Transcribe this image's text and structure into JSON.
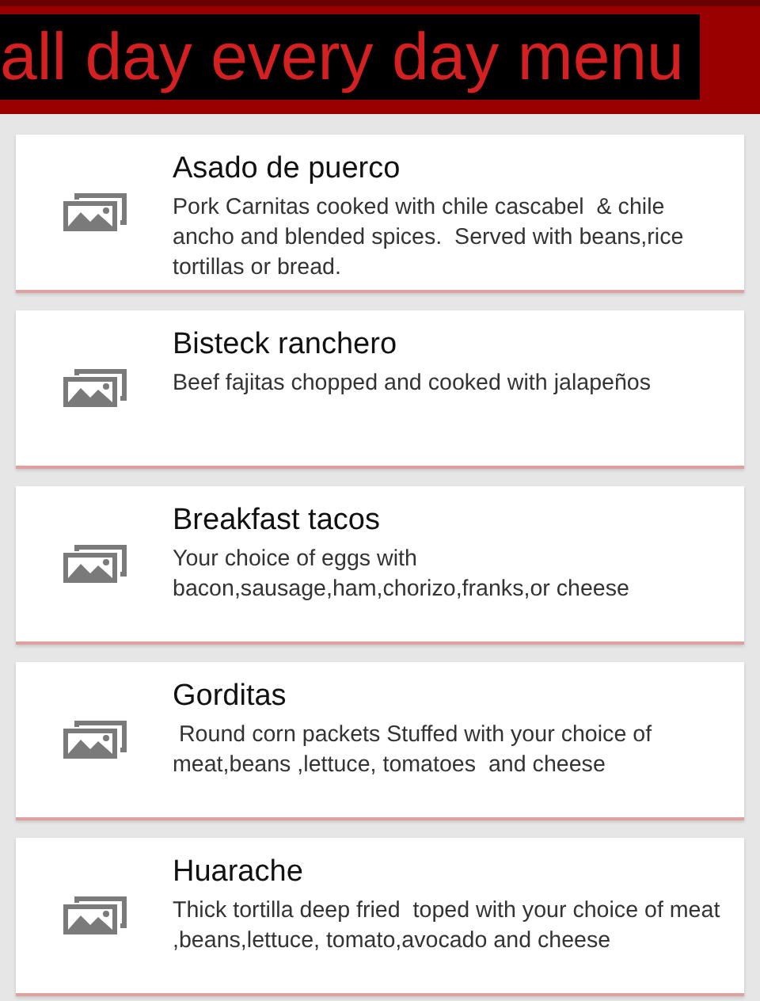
{
  "header": {
    "title": "all day every day menu"
  },
  "items": [
    {
      "name": "Asado de puerco",
      "description": "Pork Carnitas cooked with chile cascabel  & chile ancho and blended spices.  Served with beans,rice tortillas or bread."
    },
    {
      "name": "Bisteck ranchero",
      "description": "Beef fajitas chopped and cooked with jalapeños"
    },
    {
      "name": "Breakfast tacos",
      "description": "Your choice of eggs with bacon,sausage,ham,chorizo,franks,or cheese"
    },
    {
      "name": "Gorditas",
      "description": " Round corn packets Stuffed with your choice of meat,beans ,lettuce, tomatoes  and cheese"
    },
    {
      "name": "Huarache",
      "description": "Thick tortilla deep fried  toped with your choice of meat ,beans,lettuce, tomato,avocado and cheese"
    }
  ]
}
